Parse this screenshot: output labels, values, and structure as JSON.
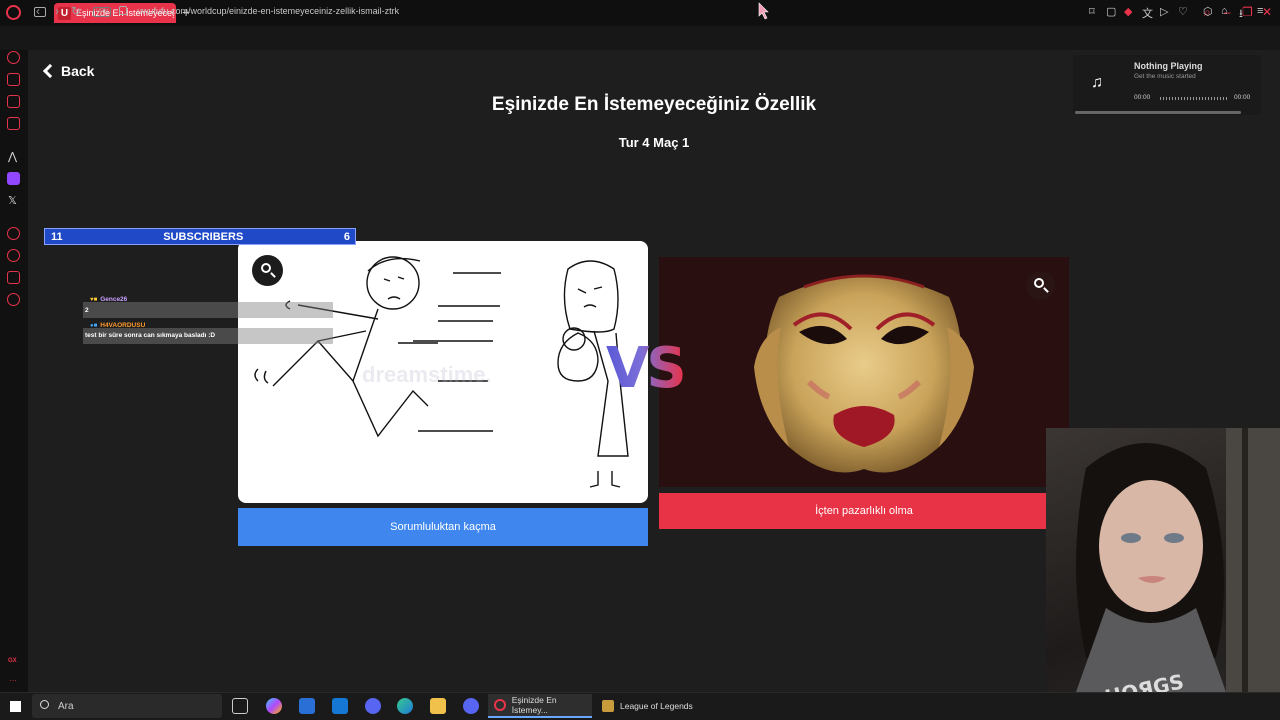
{
  "browser": {
    "tab_title": "Eşinizde En İstemeyeceğ",
    "tab_favicon": "U",
    "url": "uwufufu.com/worldcup/einizde-en-istemeyeceiniz-zellik-ismail-ztrk",
    "vpn_label": "VPN",
    "accent": "#e8334a"
  },
  "page": {
    "back_label": "Back",
    "title": "Eşinizde En İstemeyeceğiniz Özellik",
    "round_info": "Tur 4 Maç 1",
    "vs_label": "VS"
  },
  "choices": [
    {
      "label": "Sorumluluktan kaçma",
      "button_color": "#3f87ef",
      "image": "stick-figure-running-from-family"
    },
    {
      "label": "İçten pazarlıklı olma",
      "button_color": "#e83346",
      "image": "two-faced-venetian-mask"
    }
  ],
  "music_widget": {
    "title": "Nothing Playing",
    "subtitle": "Get the music started",
    "time_start": "00:00",
    "time_end": "00:00",
    "progress": 0
  },
  "stream_overlay": {
    "subscribers_label": "SUBSCRIBERS",
    "subscribers_left": "11",
    "subscribers_right": "6",
    "watermark": "dreamstime.",
    "chat": [
      {
        "user": "Gence26",
        "message": "2",
        "user_color": "#c9a0ff"
      },
      {
        "user": "H4VAORDUSU",
        "message": "test bir süre sonra can sıkmaya basladı :D",
        "user_color": "#ff9a2a"
      }
    ]
  },
  "taskbar": {
    "search_placeholder": "Ara",
    "apps": [
      {
        "label": "Eşinizde En İstemey...",
        "icon": "opera-gx-icon"
      },
      {
        "label": "League of Legends",
        "icon": "league-icon"
      }
    ]
  }
}
